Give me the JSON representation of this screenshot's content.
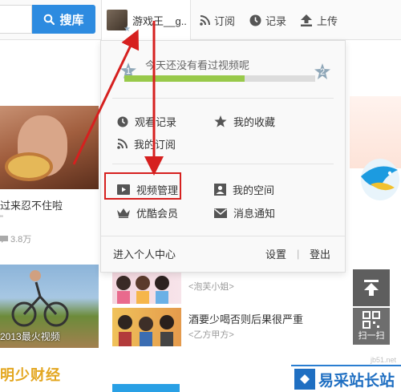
{
  "header": {
    "search_button_label": "搜库",
    "user_name": "游戏王__g..",
    "nav": [
      {
        "label": "订阅",
        "icon": "rss-icon"
      },
      {
        "label": "记录",
        "icon": "clock-icon"
      },
      {
        "label": "上传",
        "icon": "upload-icon"
      }
    ]
  },
  "dropdown": {
    "level_current": "1",
    "level_next": "2",
    "progress_text": "今天还没有看过视频呢",
    "progress_fraction": 0.63,
    "menu_group_1": [
      {
        "label": "观看记录",
        "icon": "clock-icon"
      },
      {
        "label": "我的收藏",
        "icon": "star-icon"
      },
      {
        "label": "我的订阅",
        "icon": "rss-icon"
      }
    ],
    "menu_group_2": [
      {
        "label": "视频管理",
        "icon": "video-icon"
      },
      {
        "label": "我的空间",
        "icon": "profile-card-icon"
      },
      {
        "label": "优酷会员",
        "icon": "crown-icon"
      },
      {
        "label": "消息通知",
        "icon": "mail-icon"
      }
    ],
    "footer": {
      "center_label": "进入个人中心",
      "settings_label": "设置",
      "divider": "|",
      "logout_label": "登出"
    }
  },
  "background": {
    "left_video_title": "过来忍不住啦",
    "left_video_sub": "\"",
    "left_video_views": "3.8万",
    "bike_overlay": "2013最火视频",
    "bottom_promo": "明少财经",
    "list": [
      {
        "title": "酒要少喝否则后果很严重",
        "sub": "<乙方甲方>"
      },
      {
        "title": "<泡芙小姐>",
        "sub": ""
      }
    ],
    "scroll_qr_label": "扫一扫",
    "watermark_text": "易采站长站",
    "watermark_url": "jb51.net"
  },
  "colors": {
    "search_blue": "#2d8be0",
    "progress_green": "#98c94a",
    "annotation_red": "#d6201f",
    "watermark_blue": "#1f6fc2"
  }
}
